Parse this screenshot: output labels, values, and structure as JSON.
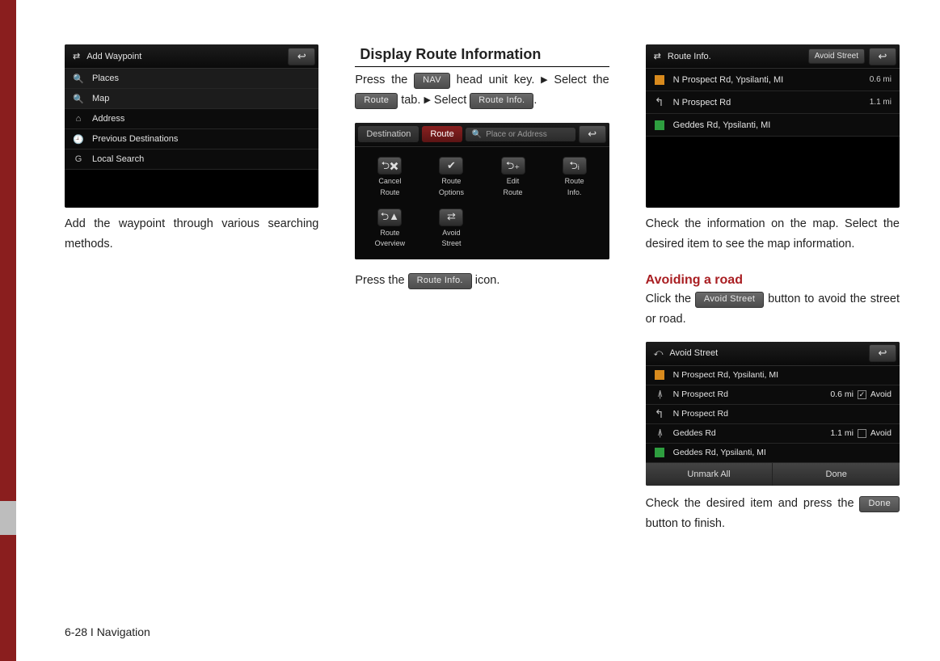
{
  "footer": "6-28 I Navigation",
  "col1": {
    "shot": {
      "title": "Add Waypoint",
      "rows": [
        {
          "icon": "🔍",
          "label": "Places"
        },
        {
          "icon": "🔍",
          "label": "Map"
        },
        {
          "icon": "⌂",
          "label": "Address"
        },
        {
          "icon": "🕘",
          "label": "Previous Destinations"
        },
        {
          "icon": "G",
          "label": "Local Search"
        }
      ]
    },
    "p1": "Add the waypoint through various search­ing methods."
  },
  "col2": {
    "heading": "Display Route Information",
    "p1a": "Press the ",
    "nav": "NAV",
    "p1b": " head unit key. ",
    "p1c": " Select the ",
    "route": "Route",
    "p1d": " tab. ",
    "p1e": " Select ",
    "routeinfo": "Route Info.",
    "shot": {
      "tabs": {
        "dest": "Destination",
        "route": "Route",
        "search": "Place or Address"
      },
      "cells": [
        {
          "icon": "⮌✖",
          "l1": "Cancel",
          "l2": "Route"
        },
        {
          "icon": "✔",
          "l1": "Route",
          "l2": "Options"
        },
        {
          "icon": "⮌₊",
          "l1": "Edit",
          "l2": "Route"
        },
        {
          "icon": "⮌ᵢ",
          "l1": "Route",
          "l2": "Info."
        },
        {
          "icon": "⮌▲",
          "l1": "Route",
          "l2": "Overview"
        },
        {
          "icon": "⇄",
          "l1": "Avoid",
          "l2": "Street"
        }
      ]
    },
    "p2a": "Press the ",
    "p2b": " icon."
  },
  "col3": {
    "shot1": {
      "title": "Route Info.",
      "avoid": "Avoid Street",
      "rows": [
        {
          "k": "orange",
          "label": "N Prospect Rd, Ypsilanti, MI",
          "dist": "0.6 mi"
        },
        {
          "k": "turn",
          "label": "N Prospect Rd",
          "dist": "1.1 mi"
        },
        {
          "k": "green",
          "label": "Geddes Rd, Ypsilanti, MI",
          "dist": ""
        }
      ]
    },
    "p1": "Check the information on the map. Select the desired item to see the map informa­tion.",
    "sub": "Avoiding a road",
    "p2a": "Click the ",
    "avoidbtn": "Avoid Street",
    "p2b": " button to avoid the street or road.",
    "shot2": {
      "title": "Avoid Street",
      "rows": [
        {
          "k": "orange",
          "label": "N Prospect Rd, Ypsilanti, MI"
        },
        {
          "k": "slash",
          "label": "N Prospect Rd",
          "dist": "0.6 mi",
          "chk": true,
          "av": "Avoid"
        },
        {
          "k": "turn",
          "label": "N Prospect Rd"
        },
        {
          "k": "slash",
          "label": "Geddes Rd",
          "dist": "1.1 mi",
          "chk": false,
          "av": "Avoid"
        },
        {
          "k": "green",
          "label": "Geddes Rd, Ypsilanti, MI"
        }
      ],
      "foot": {
        "unmark": "Unmark All",
        "done": "Done"
      }
    },
    "p3a": "Check the desired item and press the ",
    "donebtn": "Done",
    "p3b": " button to finish."
  }
}
